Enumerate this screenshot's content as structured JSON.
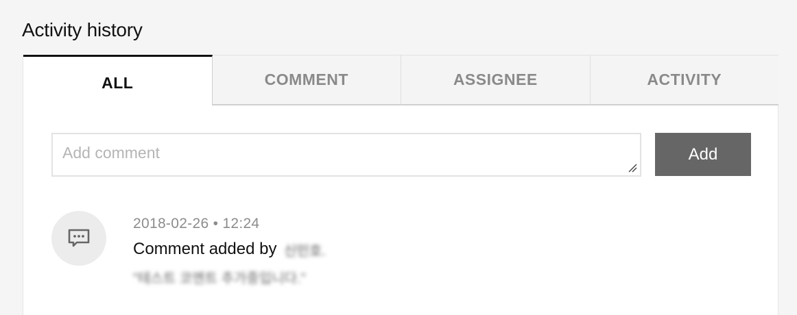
{
  "section": {
    "title": "Activity history"
  },
  "tabs": [
    {
      "label": "ALL",
      "active": true
    },
    {
      "label": "COMMENT",
      "active": false
    },
    {
      "label": "ASSIGNEE",
      "active": false
    },
    {
      "label": "ACTIVITY",
      "active": false
    }
  ],
  "composer": {
    "placeholder": "Add comment",
    "value": "",
    "add_label": "Add"
  },
  "activity": [
    {
      "icon": "comment-icon",
      "date": "2018-02-26",
      "separator": "•",
      "time": "12:24",
      "message_prefix": "Comment added by",
      "author": "신민호.",
      "comment": "\"테스트 코멘트 추가중입니다.\""
    }
  ],
  "colors": {
    "active_tab_border": "#111111",
    "add_button_bg": "#666666",
    "avatar_bg": "#ececec",
    "muted_text": "#8c8c8c"
  }
}
